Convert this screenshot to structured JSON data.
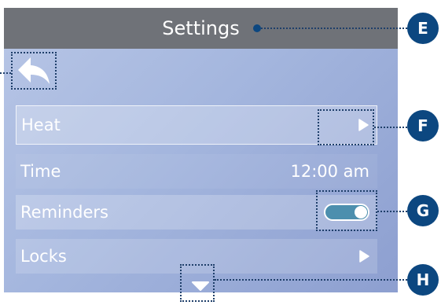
{
  "header": {
    "title": "Settings"
  },
  "rows": [
    {
      "label": "Heat",
      "value": ""
    },
    {
      "label": "Time",
      "value": "12:00 am"
    },
    {
      "label": "Reminders",
      "value": ""
    },
    {
      "label": "Locks",
      "value": ""
    }
  ],
  "reminders_toggle": {
    "on": true
  },
  "callouts": {
    "e": "E",
    "f": "F",
    "g": "G",
    "h": "H"
  },
  "icons": {
    "back": "back-arrow-icon",
    "heat_chevron": "play-arrow-right-icon",
    "locks_chevron": "play-arrow-right-icon",
    "scroll": "triangle-down-icon"
  },
  "colors": {
    "title_bar": "#6f7278",
    "screen_bg_light": "#b8c6e6",
    "screen_bg_dark": "#8d9fd0",
    "toggle_on": "#4c8fae",
    "callout_badge": "#0c4780"
  }
}
